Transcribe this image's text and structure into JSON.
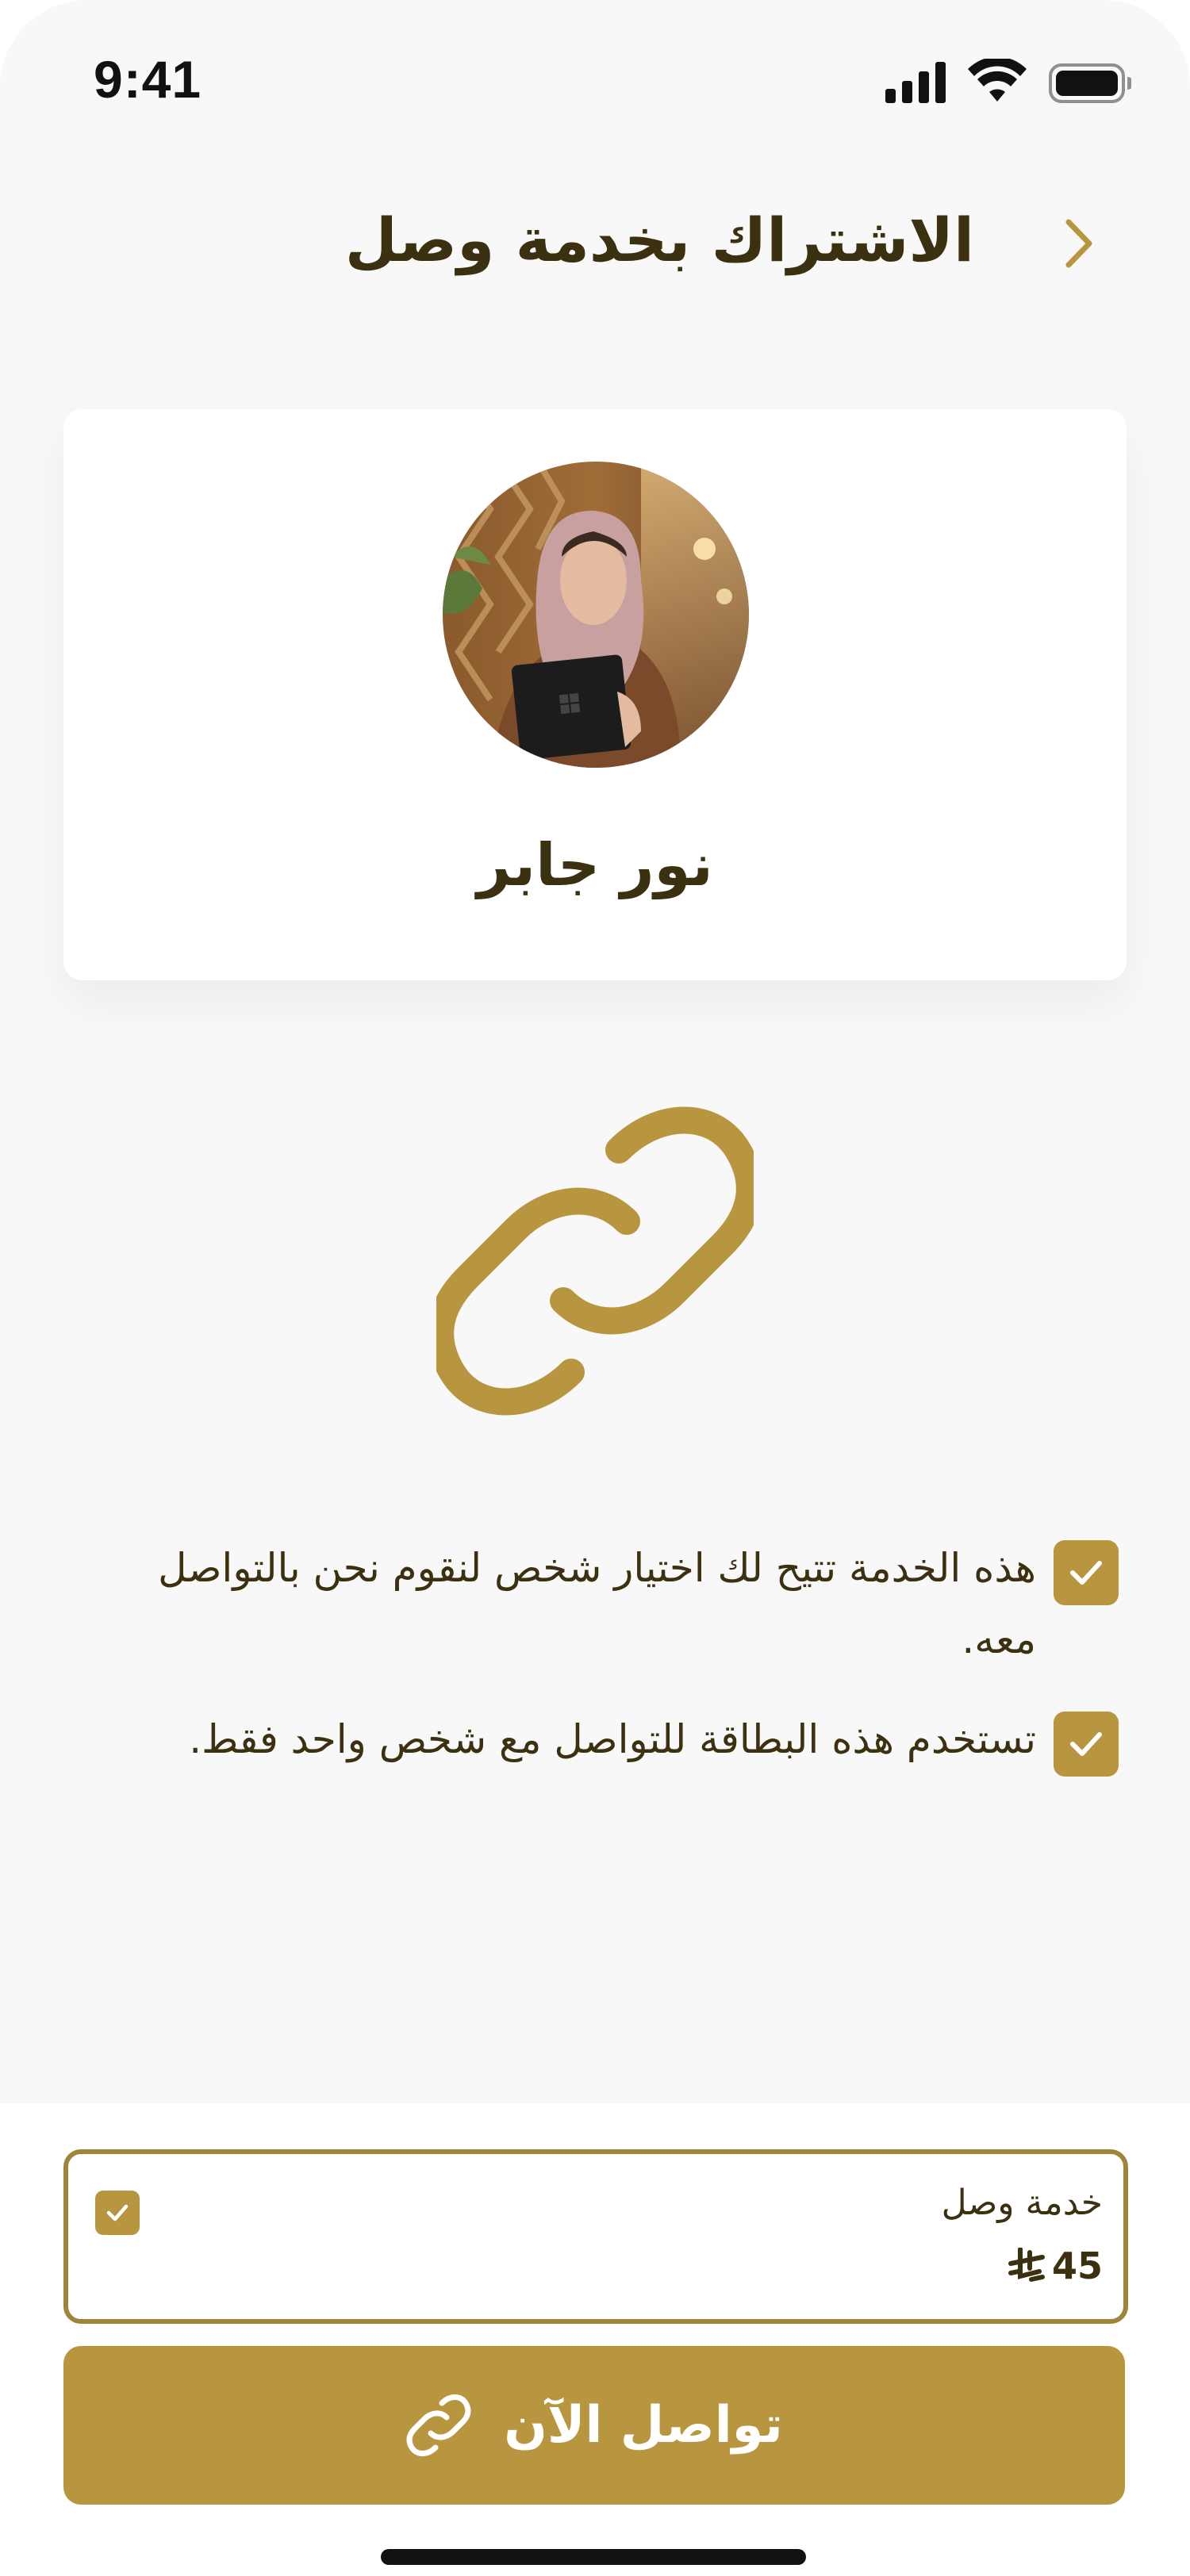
{
  "status_bar": {
    "time": "9:41"
  },
  "header": {
    "title": "الاشتراك بخدمة وصل",
    "back_icon": "chevron-right-icon"
  },
  "profile": {
    "name": "نور جابر",
    "avatar": "avatar-photo"
  },
  "illustration": {
    "icon": "link-icon"
  },
  "info_items": [
    {
      "text": "هذه الخدمة تتيح لك اختيار شخص لنقوم نحن بالتواصل معه."
    },
    {
      "text": "تستخدم هذه البطاقة للتواصل مع شخص واحد فقط."
    }
  ],
  "plan": {
    "name": "خدمة وصل",
    "price": "45",
    "selected": true
  },
  "cta": {
    "label": "تواصل الآن",
    "icon": "link-icon"
  },
  "colors": {
    "accent": "#b8963f",
    "dark_text": "#3b300f",
    "background": "#f8f8f8"
  }
}
